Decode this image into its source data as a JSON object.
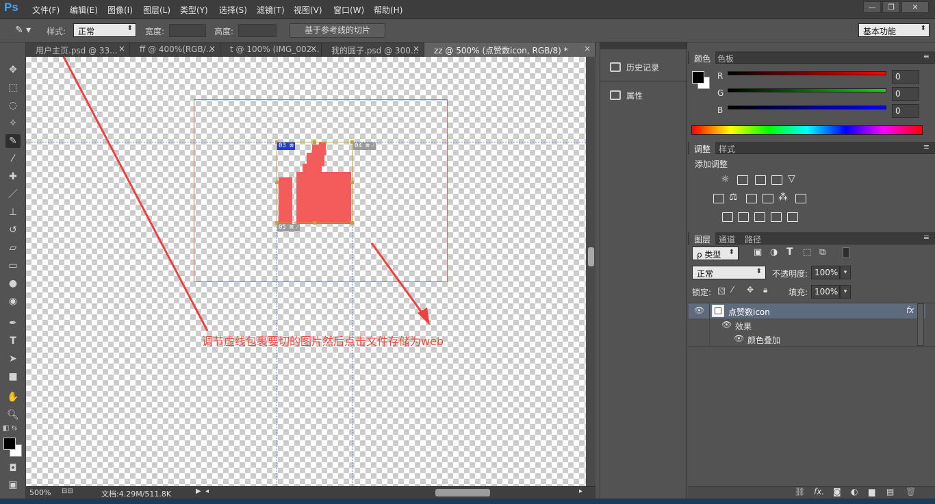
{
  "app": {
    "logo": "Ps"
  },
  "menu": [
    {
      "label": "文件(F)"
    },
    {
      "label": "编辑(E)"
    },
    {
      "label": "图像(I)"
    },
    {
      "label": "图层(L)"
    },
    {
      "label": "类型(Y)"
    },
    {
      "label": "选择(S)"
    },
    {
      "label": "滤镜(T)"
    },
    {
      "label": "视图(V)"
    },
    {
      "label": "窗口(W)"
    },
    {
      "label": "帮助(H)"
    }
  ],
  "window_buttons": {
    "minimize": "—",
    "restore": "❐",
    "close": "✕"
  },
  "options": {
    "style_label": "样式:",
    "style_value": "正常",
    "width_label": "宽度:",
    "height_label": "高度:",
    "slice_button": "基于参考线的切片",
    "workspace": "基本功能"
  },
  "tabs": [
    {
      "label": "用户主页.psd @ 33...",
      "close": "×"
    },
    {
      "label": "ff @ 400%(RGB/...",
      "close": "×"
    },
    {
      "label": "t @ 100% (IMG_002...",
      "close": "×"
    },
    {
      "label": "我的圆子.psd @ 300...",
      "close": "×"
    },
    {
      "label": "zz @ 500% (点赞数icon, RGB/8) *",
      "close": "×"
    }
  ],
  "slices": {
    "s03": "03",
    "s04": "04",
    "s05": "05"
  },
  "annotation": "调节虚线包裹要切的图片然后点击文件存储为web",
  "status": {
    "zoom": "500%",
    "doc": "文档:4.29M/511.8K"
  },
  "dock": {
    "history": "历史记录",
    "properties": "属性"
  },
  "color_panel": {
    "tab_color": "颜色",
    "tab_swatches": "色板",
    "r_label": "R",
    "g_label": "G",
    "b_label": "B",
    "r": "0",
    "g": "0",
    "b": "0",
    "fg": "#000000",
    "bg": "#ffffff"
  },
  "adjust_panel": {
    "tab_adjust": "调整",
    "tab_styles": "样式",
    "title": "添加调整"
  },
  "layers_panel": {
    "tab_layers": "图层",
    "tab_channels": "通道",
    "tab_paths": "路径",
    "filter_kind": "ρ 类型",
    "blend_mode": "正常",
    "opacity_label": "不透明度:",
    "opacity": "100%",
    "lock_label": "锁定:",
    "fill_label": "填充:",
    "fill": "100%",
    "layers": [
      {
        "name": "点赞数icon",
        "fx": "fx"
      },
      {
        "name": "效果"
      },
      {
        "name": "颜色叠加"
      }
    ]
  },
  "accent": {
    "thumb": "#f45b5b",
    "annotation": "#ef4a3e",
    "guide": "#5d7fd6"
  }
}
